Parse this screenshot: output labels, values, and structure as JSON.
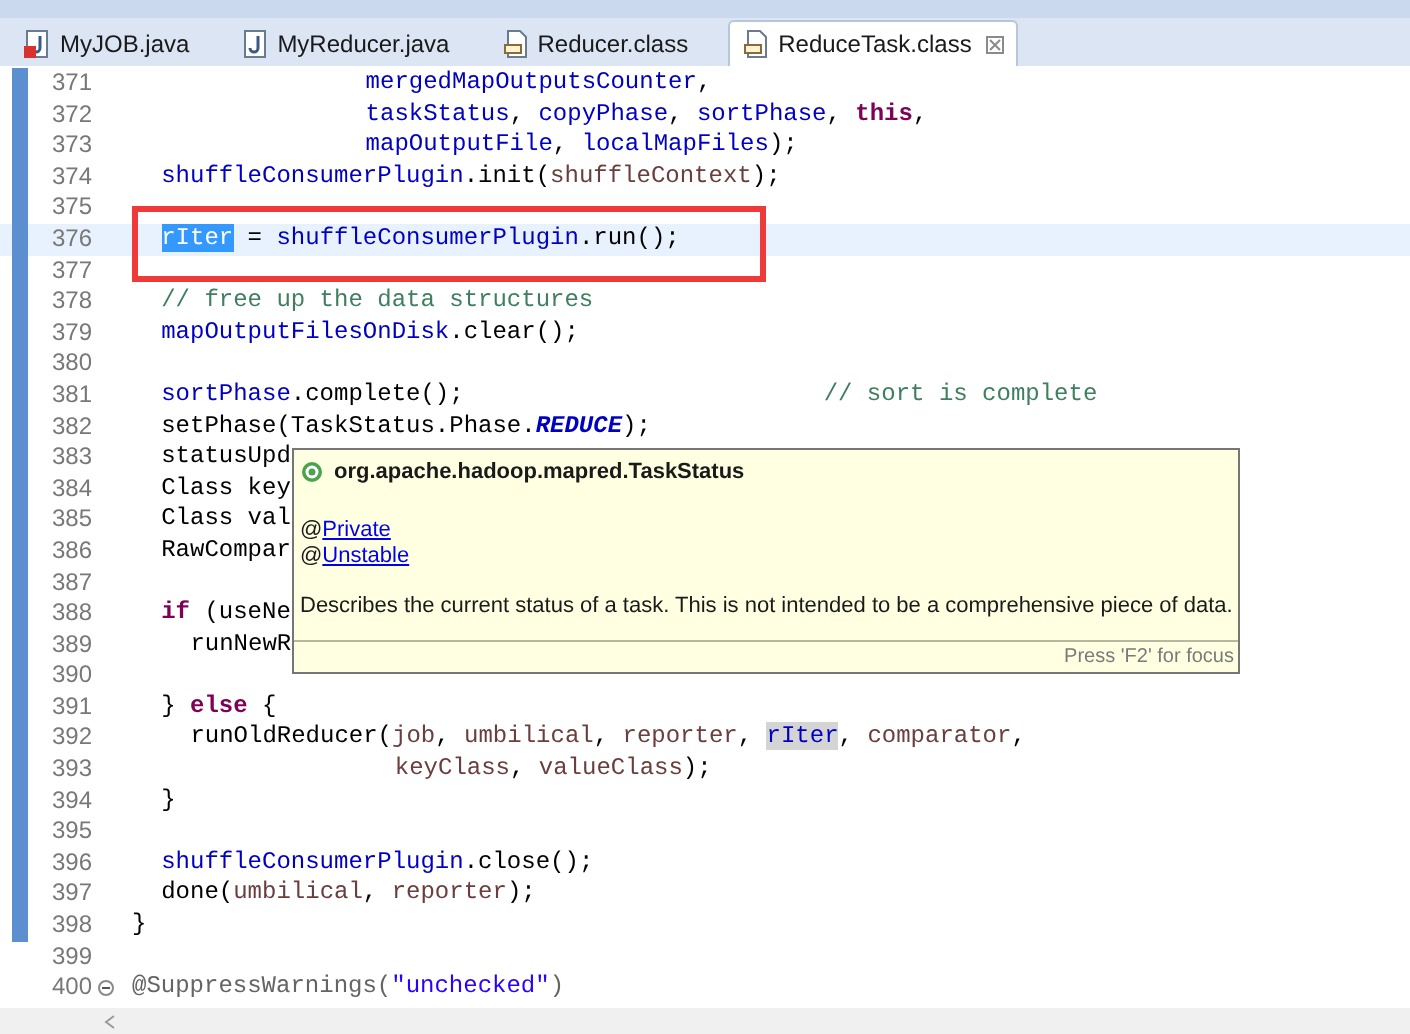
{
  "tabs": [
    {
      "label": "MyJOB.java",
      "kind": "java",
      "error": true,
      "selected": false
    },
    {
      "label": "MyReducer.java",
      "kind": "java",
      "error": false,
      "selected": false
    },
    {
      "label": "Reducer.class",
      "kind": "class",
      "error": false,
      "selected": false
    },
    {
      "label": "ReduceTask.class",
      "kind": "class",
      "error": false,
      "selected": true
    }
  ],
  "lines": [
    {
      "number": "371",
      "kind": "wrap",
      "changed": true,
      "current": false,
      "boxed": false,
      "segments": [
        {
          "text": "mergedMapOutputsCounter",
          "kind": "field"
        },
        {
          "text": ",",
          "kind": "plain"
        }
      ]
    },
    {
      "number": "372",
      "kind": "wrap",
      "changed": true,
      "current": false,
      "boxed": false,
      "segments": [
        {
          "text": "taskStatus",
          "kind": "field"
        },
        {
          "text": ", ",
          "kind": "plain"
        },
        {
          "text": "copyPhase",
          "kind": "field"
        },
        {
          "text": ", ",
          "kind": "plain"
        },
        {
          "text": "sortPhase",
          "kind": "field"
        },
        {
          "text": ", ",
          "kind": "plain"
        },
        {
          "text": "this",
          "kind": "keyword"
        },
        {
          "text": ",",
          "kind": "plain"
        }
      ]
    },
    {
      "number": "373",
      "kind": "wrap",
      "changed": true,
      "current": false,
      "boxed": false,
      "segments": [
        {
          "text": "mapOutputFile",
          "kind": "field"
        },
        {
          "text": ", ",
          "kind": "plain"
        },
        {
          "text": "localMapFiles",
          "kind": "field"
        },
        {
          "text": ");",
          "kind": "plain"
        }
      ]
    },
    {
      "number": "374",
      "kind": "block",
      "changed": true,
      "current": false,
      "boxed": false,
      "segments": [
        {
          "text": "shuffleConsumerPlugin",
          "kind": "field"
        },
        {
          "text": ".init(",
          "kind": "plain"
        },
        {
          "text": "shuffleContext",
          "kind": "local"
        },
        {
          "text": ");",
          "kind": "plain"
        }
      ]
    },
    {
      "number": "375",
      "changed": true,
      "current": false,
      "boxed": false
    },
    {
      "number": "376",
      "kind": "block",
      "changed": true,
      "current": true,
      "boxed": true,
      "segments": [
        {
          "text": "rIter",
          "kind": "selection"
        },
        {
          "text": " = ",
          "kind": "plain"
        },
        {
          "text": "shuffleConsumerPlugin",
          "kind": "field"
        },
        {
          "text": ".run();",
          "kind": "plain"
        }
      ]
    },
    {
      "number": "377",
      "changed": true,
      "current": false,
      "boxed": false
    },
    {
      "number": "378",
      "kind": "block",
      "changed": true,
      "current": false,
      "boxed": false,
      "segments": [
        {
          "text": "// free up the data structures",
          "kind": "comment"
        }
      ]
    },
    {
      "number": "379",
      "kind": "block",
      "changed": true,
      "current": false,
      "boxed": false,
      "segments": [
        {
          "text": "mapOutputFilesOnDisk",
          "kind": "field"
        },
        {
          "text": ".clear();",
          "kind": "plain"
        }
      ]
    },
    {
      "number": "380",
      "changed": true,
      "current": false,
      "boxed": false
    },
    {
      "number": "381",
      "kind": "block",
      "changed": true,
      "current": false,
      "boxed": false,
      "segments": [
        {
          "text": "sortPhase",
          "kind": "field"
        },
        {
          "text": ".complete();",
          "kind": "plain"
        },
        {
          "text": "// sort is complete",
          "kind": "trailing-comment"
        }
      ]
    },
    {
      "number": "382",
      "kind": "block",
      "changed": true,
      "current": false,
      "boxed": false,
      "segments": [
        {
          "text": "setPhase(TaskStatus.Phase.",
          "kind": "plain"
        },
        {
          "text": "REDUCE",
          "kind": "static"
        },
        {
          "text": ");",
          "kind": "plain"
        }
      ]
    },
    {
      "number": "383",
      "kind": "block",
      "changed": true,
      "current": false,
      "boxed": false,
      "segments": [
        {
          "text": "statusUpd",
          "kind": "plain"
        }
      ]
    },
    {
      "number": "384",
      "kind": "block",
      "changed": true,
      "current": false,
      "boxed": false,
      "segments": [
        {
          "text": "Class key",
          "kind": "plain"
        }
      ]
    },
    {
      "number": "385",
      "kind": "block",
      "changed": true,
      "current": false,
      "boxed": false,
      "segments": [
        {
          "text": "Class val",
          "kind": "plain"
        }
      ]
    },
    {
      "number": "386",
      "kind": "block",
      "changed": true,
      "current": false,
      "boxed": false,
      "segments": [
        {
          "text": "RawCompar",
          "kind": "plain"
        }
      ]
    },
    {
      "number": "387",
      "changed": true,
      "current": false,
      "boxed": false
    },
    {
      "number": "388",
      "kind": "block",
      "changed": true,
      "current": false,
      "boxed": false,
      "segments": [
        {
          "text": "if",
          "kind": "keyword"
        },
        {
          "text": " (useNe",
          "kind": "plain"
        }
      ]
    },
    {
      "number": "389",
      "kind": "inner",
      "changed": true,
      "current": false,
      "boxed": false,
      "segments": [
        {
          "text": "runNewR",
          "kind": "plain"
        }
      ]
    },
    {
      "number": "390",
      "changed": true,
      "current": false,
      "boxed": false
    },
    {
      "number": "391",
      "kind": "block",
      "changed": true,
      "current": false,
      "boxed": false,
      "segments": [
        {
          "text": "} ",
          "kind": "plain"
        },
        {
          "text": "else",
          "kind": "keyword"
        },
        {
          "text": " {",
          "kind": "plain"
        }
      ]
    },
    {
      "number": "392",
      "kind": "inner",
      "changed": true,
      "current": false,
      "boxed": false,
      "segments": [
        {
          "text": "runOldReducer(",
          "kind": "plain"
        },
        {
          "text": "job",
          "kind": "local"
        },
        {
          "text": ", ",
          "kind": "plain"
        },
        {
          "text": "umbilical",
          "kind": "local"
        },
        {
          "text": ", ",
          "kind": "plain"
        },
        {
          "text": "reporter",
          "kind": "local"
        },
        {
          "text": ", ",
          "kind": "plain"
        },
        {
          "text": "rIter",
          "kind": "occurrence"
        },
        {
          "text": ", ",
          "kind": "plain"
        },
        {
          "text": "comparator",
          "kind": "local"
        },
        {
          "text": ",",
          "kind": "plain"
        }
      ]
    },
    {
      "number": "393",
      "kind": "deep",
      "changed": true,
      "current": false,
      "boxed": false,
      "segments": [
        {
          "text": "keyClass",
          "kind": "local"
        },
        {
          "text": ", ",
          "kind": "plain"
        },
        {
          "text": "valueClass",
          "kind": "local"
        },
        {
          "text": ");",
          "kind": "plain"
        }
      ]
    },
    {
      "number": "394",
      "kind": "block",
      "changed": true,
      "current": false,
      "boxed": false,
      "segments": [
        {
          "text": "}",
          "kind": "plain"
        }
      ]
    },
    {
      "number": "395",
      "changed": true,
      "current": false,
      "boxed": false
    },
    {
      "number": "396",
      "kind": "block",
      "changed": true,
      "current": false,
      "boxed": false,
      "segments": [
        {
          "text": "shuffleConsumerPlugin",
          "kind": "field"
        },
        {
          "text": ".close();",
          "kind": "plain"
        }
      ]
    },
    {
      "number": "397",
      "kind": "block",
      "changed": true,
      "current": false,
      "boxed": false,
      "segments": [
        {
          "text": "done(",
          "kind": "plain"
        },
        {
          "text": "umbilical",
          "kind": "local"
        },
        {
          "text": ", ",
          "kind": "plain"
        },
        {
          "text": "reporter",
          "kind": "local"
        },
        {
          "text": ");",
          "kind": "plain"
        }
      ]
    },
    {
      "number": "398",
      "kind": "top",
      "changed": true,
      "current": false,
      "boxed": false,
      "segments": [
        {
          "text": "}",
          "kind": "plain"
        }
      ]
    },
    {
      "number": "399",
      "changed": false,
      "current": false,
      "boxed": false
    },
    {
      "number": "400",
      "kind": "top",
      "changed": false,
      "current": false,
      "boxed": false,
      "fold": true,
      "segments": [
        {
          "text": "@SuppressWarnings(",
          "kind": "annotation"
        },
        {
          "text": "\"unchecked\"",
          "kind": "string"
        },
        {
          "text": ")",
          "kind": "annotation"
        }
      ]
    }
  ],
  "tooltip": {
    "title": "org.apache.hadoop.mapred.TaskStatus",
    "annotations": [
      {
        "at": "@",
        "link": "Private"
      },
      {
        "at": "@",
        "link": "Unstable"
      }
    ],
    "description": "Describes the current status of a task. This is not intended to be a comprehensive piece of data.",
    "footer": "Press 'F2' for focus"
  }
}
